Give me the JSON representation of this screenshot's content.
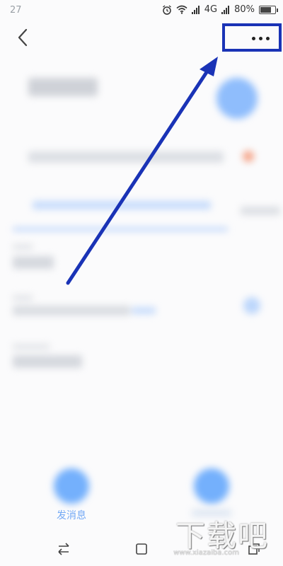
{
  "status_bar": {
    "time": "27",
    "network": "4G",
    "battery_percent": "80%",
    "battery_level": 0.8,
    "icons": [
      "alarm-icon",
      "wifi-icon",
      "signal-icon",
      "signal-icon",
      "battery-icon"
    ]
  },
  "nav": {
    "back_icon": "chevron-left-icon",
    "more_icon": "more-dots-icon"
  },
  "annotation": {
    "highlight_color": "#1a33b6",
    "arrow_color": "#1a33b6"
  },
  "actions": {
    "send_message_label": "发消息",
    "send_color": "#74b0fc"
  },
  "bottom_nav": {
    "icons": [
      "switch-icon",
      "home-icon",
      "recent-apps-icon"
    ]
  },
  "watermark": {
    "text": "下载吧",
    "sub": "www.xiazaiba.com"
  }
}
